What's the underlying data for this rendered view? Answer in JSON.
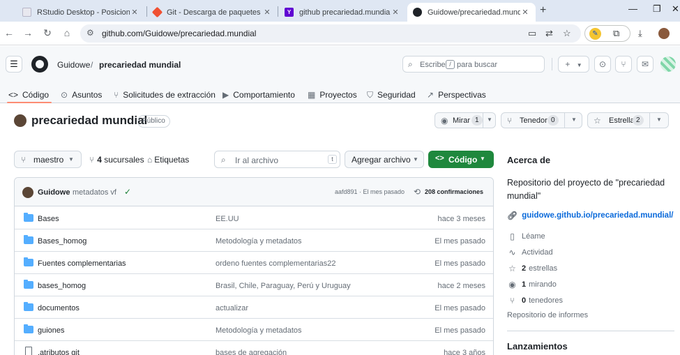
{
  "browser": {
    "tabs": [
      {
        "title": "RStudio Desktop - Posicionar",
        "favicon_color": "#e8e8ef"
      },
      {
        "title": "Git - Descarga de paquetes",
        "favicon_color": "#f05133"
      },
      {
        "title": "github precariedad.mundial - Y",
        "favicon_color": "#6001d2"
      },
      {
        "title": "Guidowe/precariedad.mundial",
        "favicon_color": "#1f2328"
      }
    ],
    "url": "github.com/Guidowe/precariedad.mundial"
  },
  "header": {
    "owner": "Guidowe",
    "separator": "/",
    "repo": "precariedad mundial",
    "search_prefix": "Escribe",
    "search_key": "/",
    "search_suffix": "para buscar"
  },
  "repo_nav": [
    {
      "label": "Código",
      "icon": "code-icon"
    },
    {
      "label": "Asuntos",
      "icon": "issue-icon"
    },
    {
      "label": "Solicitudes de extracción",
      "icon": "pull-request-icon"
    },
    {
      "label": "Comportamiento",
      "icon": "play-icon"
    },
    {
      "label": "Proyectos",
      "icon": "table-icon"
    },
    {
      "label": "Seguridad",
      "icon": "shield-icon"
    },
    {
      "label": "Perspectivas",
      "icon": "graph-icon"
    }
  ],
  "repo": {
    "title": "precariedad mundial",
    "visibility": "Público",
    "watch_label": "Mirar",
    "watch_count": "1",
    "fork_label": "Tenedor",
    "fork_count": "0",
    "star_label": "Estrella",
    "star_count": "2"
  },
  "toolbar": {
    "branch": "maestro",
    "branches_count": "4",
    "branches_label": "sucursales",
    "tags_label": "Etiquetas",
    "goto_file": "Ir al archivo",
    "goto_key": "t",
    "add_file": "Agregar archivo",
    "code": "Código"
  },
  "commit": {
    "author": "Guidowe",
    "message": "metadatos vf",
    "hash_time": "aafd891 · El mes pasado",
    "commits_count": "208",
    "commits_label": "confirmaciones"
  },
  "files": [
    {
      "name": "Bases",
      "type": "folder",
      "message": "EE.UU",
      "date": "hace 3 meses"
    },
    {
      "name": "Bases_homog",
      "type": "folder",
      "message": "Metodología y metadatos",
      "date": "El mes pasado"
    },
    {
      "name": "Fuentes complementarias",
      "type": "folder",
      "message": "ordeno fuentes complementarias22",
      "date": "El mes pasado"
    },
    {
      "name": "bases_homog",
      "type": "folder",
      "message": "Brasil, Chile, Paraguay, Perú y Uruguay",
      "date": "hace 2 meses"
    },
    {
      "name": "documentos",
      "type": "folder",
      "message": "actualizar",
      "date": "El mes pasado"
    },
    {
      "name": "guiones",
      "type": "folder",
      "message": "Metodología y metadatos",
      "date": "El mes pasado"
    },
    {
      "name": ".atributos git",
      "type": "file",
      "message": "bases de agregación",
      "date": "hace 3 años"
    }
  ],
  "about": {
    "title": "Acerca de",
    "description": "Repositorio del proyecto de \"precariedad mundial\"",
    "link": "guidowe.github.io/precariedad.mundial/",
    "readme": "Léame",
    "activity": "Actividad",
    "stars_count": "2",
    "stars_label": "estrellas",
    "watching_count": "1",
    "watching_label": "mirando",
    "forks_count": "0",
    "forks_label": "tenedores",
    "report": "Repositorio de informes"
  },
  "releases": {
    "title": "Lanzamientos"
  },
  "colors": {
    "accent_green": "#1f883d",
    "link_blue": "#0969da",
    "tab_underline": "#fd8c73",
    "folder_blue": "#54aeff"
  }
}
